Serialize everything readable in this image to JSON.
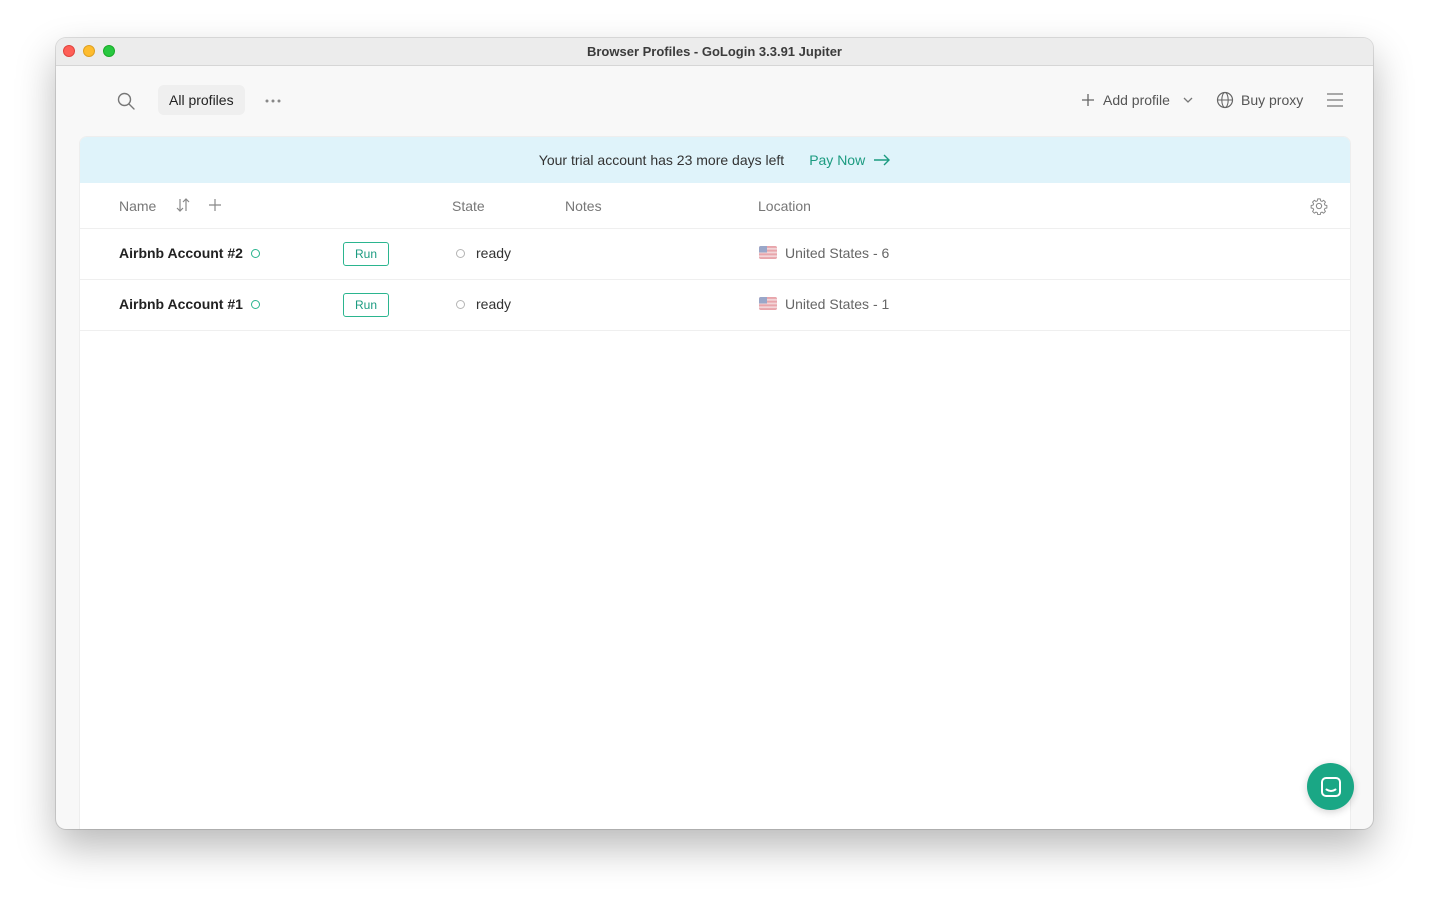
{
  "window": {
    "title": "Browser Profiles - GoLogin 3.3.91 Jupiter"
  },
  "toolbar": {
    "search_icon": "search-icon",
    "all_profiles_tab": "All profiles",
    "more_icon": "more-dots-icon",
    "add_profile_label": "Add profile",
    "buy_proxy_label": "Buy proxy",
    "menu_icon": "hamburger-menu-icon"
  },
  "banner": {
    "message": "Your trial account has 23 more days left",
    "pay_now_label": "Pay Now"
  },
  "table": {
    "columns": {
      "name": "Name",
      "state": "State",
      "notes": "Notes",
      "location": "Location"
    },
    "rows": [
      {
        "name": "Airbnb Account #2",
        "run_label": "Run",
        "state": "ready",
        "notes": "",
        "location": "United States - 6"
      },
      {
        "name": "Airbnb Account #1",
        "run_label": "Run",
        "state": "ready",
        "notes": "",
        "location": "United States - 1"
      }
    ]
  },
  "colors": {
    "accent": "#1aa785",
    "banner_bg": "#dff3fa",
    "status_green": "#2bb58f"
  }
}
